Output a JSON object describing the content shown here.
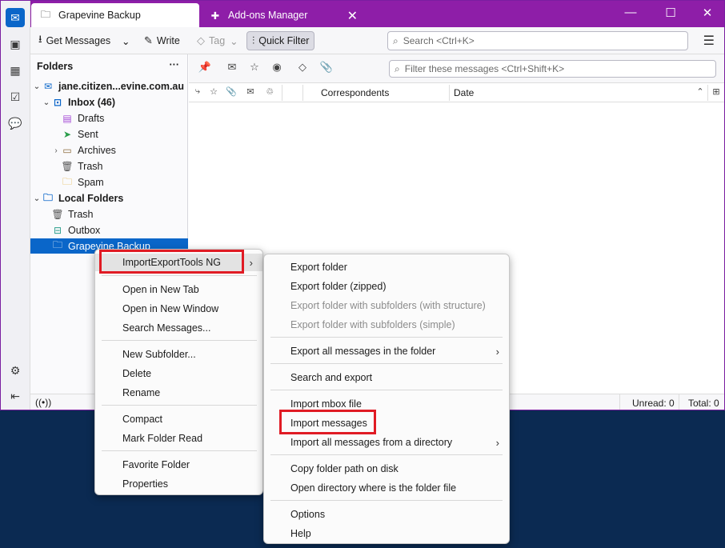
{
  "tabs": [
    {
      "label": "Grapevine Backup",
      "icon": "folder-icon"
    },
    {
      "label": "Add-ons Manager",
      "icon": "puzzle-icon"
    }
  ],
  "toolbar": {
    "get_messages": "Get Messages",
    "write": "Write",
    "tag": "Tag",
    "quick_filter": "Quick Filter",
    "search_placeholder": "Search <Ctrl+K>"
  },
  "folder_pane": {
    "header": "Folders",
    "folders": [
      {
        "label": "jane.citizen...evine.com.au",
        "icon": "account-icon"
      },
      {
        "label": "Inbox (46)",
        "icon": "inbox-icon"
      },
      {
        "label": "Drafts",
        "icon": "drafts-icon"
      },
      {
        "label": "Sent",
        "icon": "sent-icon"
      },
      {
        "label": "Archives",
        "icon": "archive-icon"
      },
      {
        "label": "Trash",
        "icon": "trash-icon"
      },
      {
        "label": "Spam",
        "icon": "spam-icon"
      },
      {
        "label": "Local Folders",
        "icon": "local-folders-icon"
      },
      {
        "label": "Trash",
        "icon": "trash-icon"
      },
      {
        "label": "Outbox",
        "icon": "outbox-icon"
      },
      {
        "label": "Grapevine Backup",
        "icon": "folder-icon"
      }
    ]
  },
  "message_pane": {
    "filter_placeholder": "Filter these messages <Ctrl+Shift+K>",
    "col_correspondents": "Correspondents",
    "col_date": "Date"
  },
  "status": {
    "unread": "Unread: 0",
    "total": "Total: 0"
  },
  "context_menu": {
    "items": [
      "ImportExportTools NG",
      "Open in New Tab",
      "Open in New Window",
      "Search Messages...",
      "New Subfolder...",
      "Delete",
      "Rename",
      "Compact",
      "Mark Folder Read",
      "Favorite Folder",
      "Properties"
    ]
  },
  "submenu": {
    "items": [
      "Export folder",
      "Export folder (zipped)",
      "Export folder with subfolders (with structure)",
      "Export folder with subfolders (simple)",
      "Export all messages in the folder",
      "Search and export",
      "Import mbox file",
      "Import messages",
      "Import all messages from a directory",
      "Copy folder path on disk",
      "Open directory where is the folder file",
      "Options",
      "Help"
    ]
  },
  "colors": {
    "titlebar": "#8e1ea8",
    "accent": "#0a66c9",
    "highlight_box": "#e01b24",
    "desktop": "#0b2a52"
  }
}
